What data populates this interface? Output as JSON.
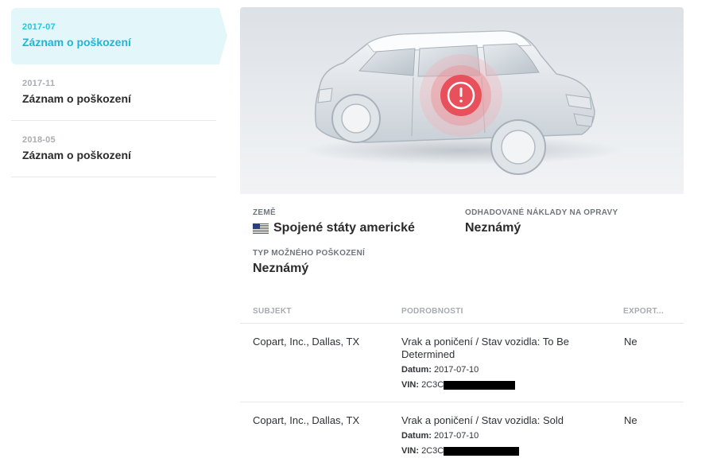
{
  "sidebar": {
    "items": [
      {
        "date": "2017-07",
        "title": "Záznam o poškození",
        "active": true
      },
      {
        "date": "2017-11",
        "title": "Záznam o poškození",
        "active": false
      },
      {
        "date": "2018-05",
        "title": "Záznam o poškození",
        "active": false
      }
    ]
  },
  "hero": {
    "alert_icon": "exclamation-circle-icon",
    "alert_color": "#e8505b"
  },
  "info": {
    "country_label": "ZEMĚ",
    "country_value": "Spojené státy americké",
    "country_flag": "us-flag-icon",
    "cost_label": "ODHADOVANÉ NÁKLADY NA OPRAVY",
    "cost_value": "Neznámý",
    "damage_type_label": "TYP MOŽNÉHO POŠKOZENÍ",
    "damage_type_value": "Neznámý"
  },
  "table": {
    "headers": {
      "subject": "SUBJEKT",
      "details": "PODROBNOSTI",
      "export": "EXPORT..."
    },
    "rows": [
      {
        "subject": "Copart, Inc., Dallas, TX",
        "details": "Vrak a poničení / Stav vozidla: To Be Determined",
        "date_label": "Datum:",
        "date": "2017-07-10",
        "vin_label": "VIN:",
        "vin": "2C3C",
        "export": "Ne"
      },
      {
        "subject": "Copart, Inc., Dallas, TX",
        "details": "Vrak a poničení / Stav vozidla: Sold",
        "date_label": "Datum:",
        "date": "2017-07-10",
        "vin_label": "VIN:",
        "vin": "2C3C",
        "export": "Ne"
      }
    ]
  }
}
